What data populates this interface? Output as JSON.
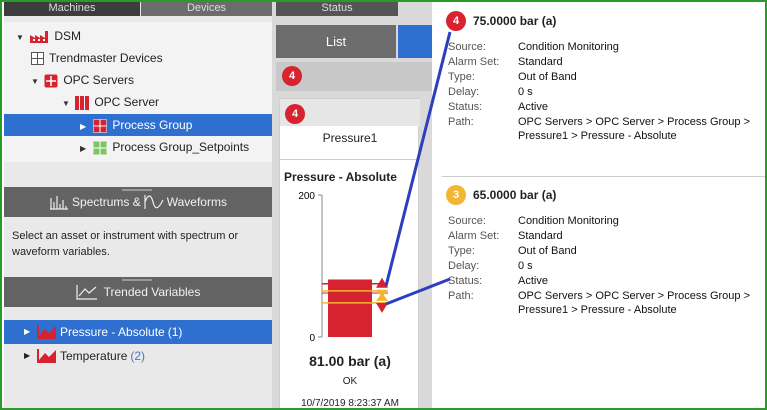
{
  "tabs": {
    "machines": "Machines",
    "devices": "Devices",
    "status": "Status"
  },
  "tree": {
    "root": "DSM",
    "trendmaster": "Trendmaster Devices",
    "opc_servers": "OPC Servers",
    "opc_server": "OPC Server",
    "process_group": "Process Group",
    "process_group_setpoints": "Process Group_Setpoints"
  },
  "spectrum_section": {
    "title_a": "Spectrums &",
    "title_b": "Waveforms",
    "message": "Select an asset or instrument with spectrum or waveform variables."
  },
  "trend_section": {
    "title": "Trended Variables",
    "items": [
      {
        "label": "Pressure - Absolute",
        "count": "(1)"
      },
      {
        "label": "Temperature",
        "count": "(2)"
      }
    ]
  },
  "middle": {
    "list_label": "List",
    "alarm_count": "4",
    "card_badge": "4",
    "card_name": "Pressure1",
    "measurement": "Pressure - Absolute",
    "axis_max": "200",
    "axis_min": "0",
    "value": "81.00 bar (a)",
    "status": "OK",
    "timestamp": "10/7/2019 8:23:37 AM"
  },
  "chart_data": {
    "type": "bar",
    "categories": [
      "Pressure - Absolute"
    ],
    "values": [
      81
    ],
    "ylim": [
      0,
      200
    ],
    "thresholds": [
      75,
      65
    ]
  },
  "alarms": [
    {
      "badge": "4",
      "value": "75.0000 bar (a)",
      "rows": [
        {
          "k": "Source:",
          "v": "Condition Monitoring"
        },
        {
          "k": "Alarm Set:",
          "v": "Standard"
        },
        {
          "k": "Type:",
          "v": "Out of Band"
        },
        {
          "k": "Delay:",
          "v": "0 s"
        },
        {
          "k": "Status:",
          "v": "Active"
        },
        {
          "k": "Path:",
          "v": "OPC Servers > OPC Server > Process Group > Pressure1 > Pressure - Absolute"
        }
      ]
    },
    {
      "badge": "3",
      "value": "65.0000 bar (a)",
      "rows": [
        {
          "k": "Source:",
          "v": "Condition Monitoring"
        },
        {
          "k": "Alarm Set:",
          "v": "Standard"
        },
        {
          "k": "Type:",
          "v": "Out of Band"
        },
        {
          "k": "Delay:",
          "v": "0 s"
        },
        {
          "k": "Status:",
          "v": "Active"
        },
        {
          "k": "Path:",
          "v": "OPC Servers > OPC Server > Process Group > Pressure1 > Pressure - Absolute"
        }
      ]
    }
  ],
  "colors": {
    "danger": "#d6232f",
    "alert": "#f2b632",
    "selected": "#2f6fd0",
    "line": "#2b3fbf"
  }
}
